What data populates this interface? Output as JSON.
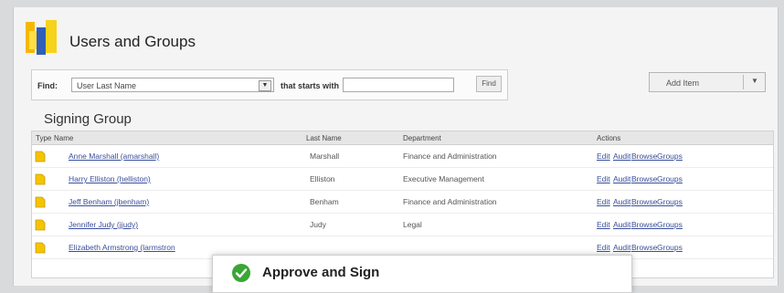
{
  "header": {
    "title": "Users and Groups"
  },
  "find": {
    "label": "Find:",
    "field_value": "User Last Name",
    "starts_label": "that starts with",
    "input_value": "",
    "button_label": "Find"
  },
  "add_item": {
    "label": "Add Item"
  },
  "section": {
    "title": "Signing Group"
  },
  "table": {
    "columns": [
      "Type",
      "Name",
      "Last Name",
      "Department",
      "Actions"
    ],
    "rows": [
      {
        "name": "Anne Marshall (amarshall)",
        "last": "Marshall",
        "dept": "Finance and Administration"
      },
      {
        "name": "Harry Elliston (helliston)",
        "last": "Elliston",
        "dept": "Executive Management"
      },
      {
        "name": "Jeff Benham (jbenham)",
        "last": "Benham",
        "dept": "Finance and Administration"
      },
      {
        "name": "Jennifer Judy (jjudy)",
        "last": "Judy",
        "dept": "Legal"
      },
      {
        "name": "Elizabeth Armstrong (larmstron",
        "last": "",
        "dept": ""
      }
    ],
    "actions": [
      "Edit",
      "Audit",
      "Browse",
      "Groups"
    ]
  },
  "dialog": {
    "title": "Approve and Sign"
  },
  "colors": {
    "link": "#3a4f9a",
    "folder": "#f5c400",
    "check": "#3aa635"
  }
}
